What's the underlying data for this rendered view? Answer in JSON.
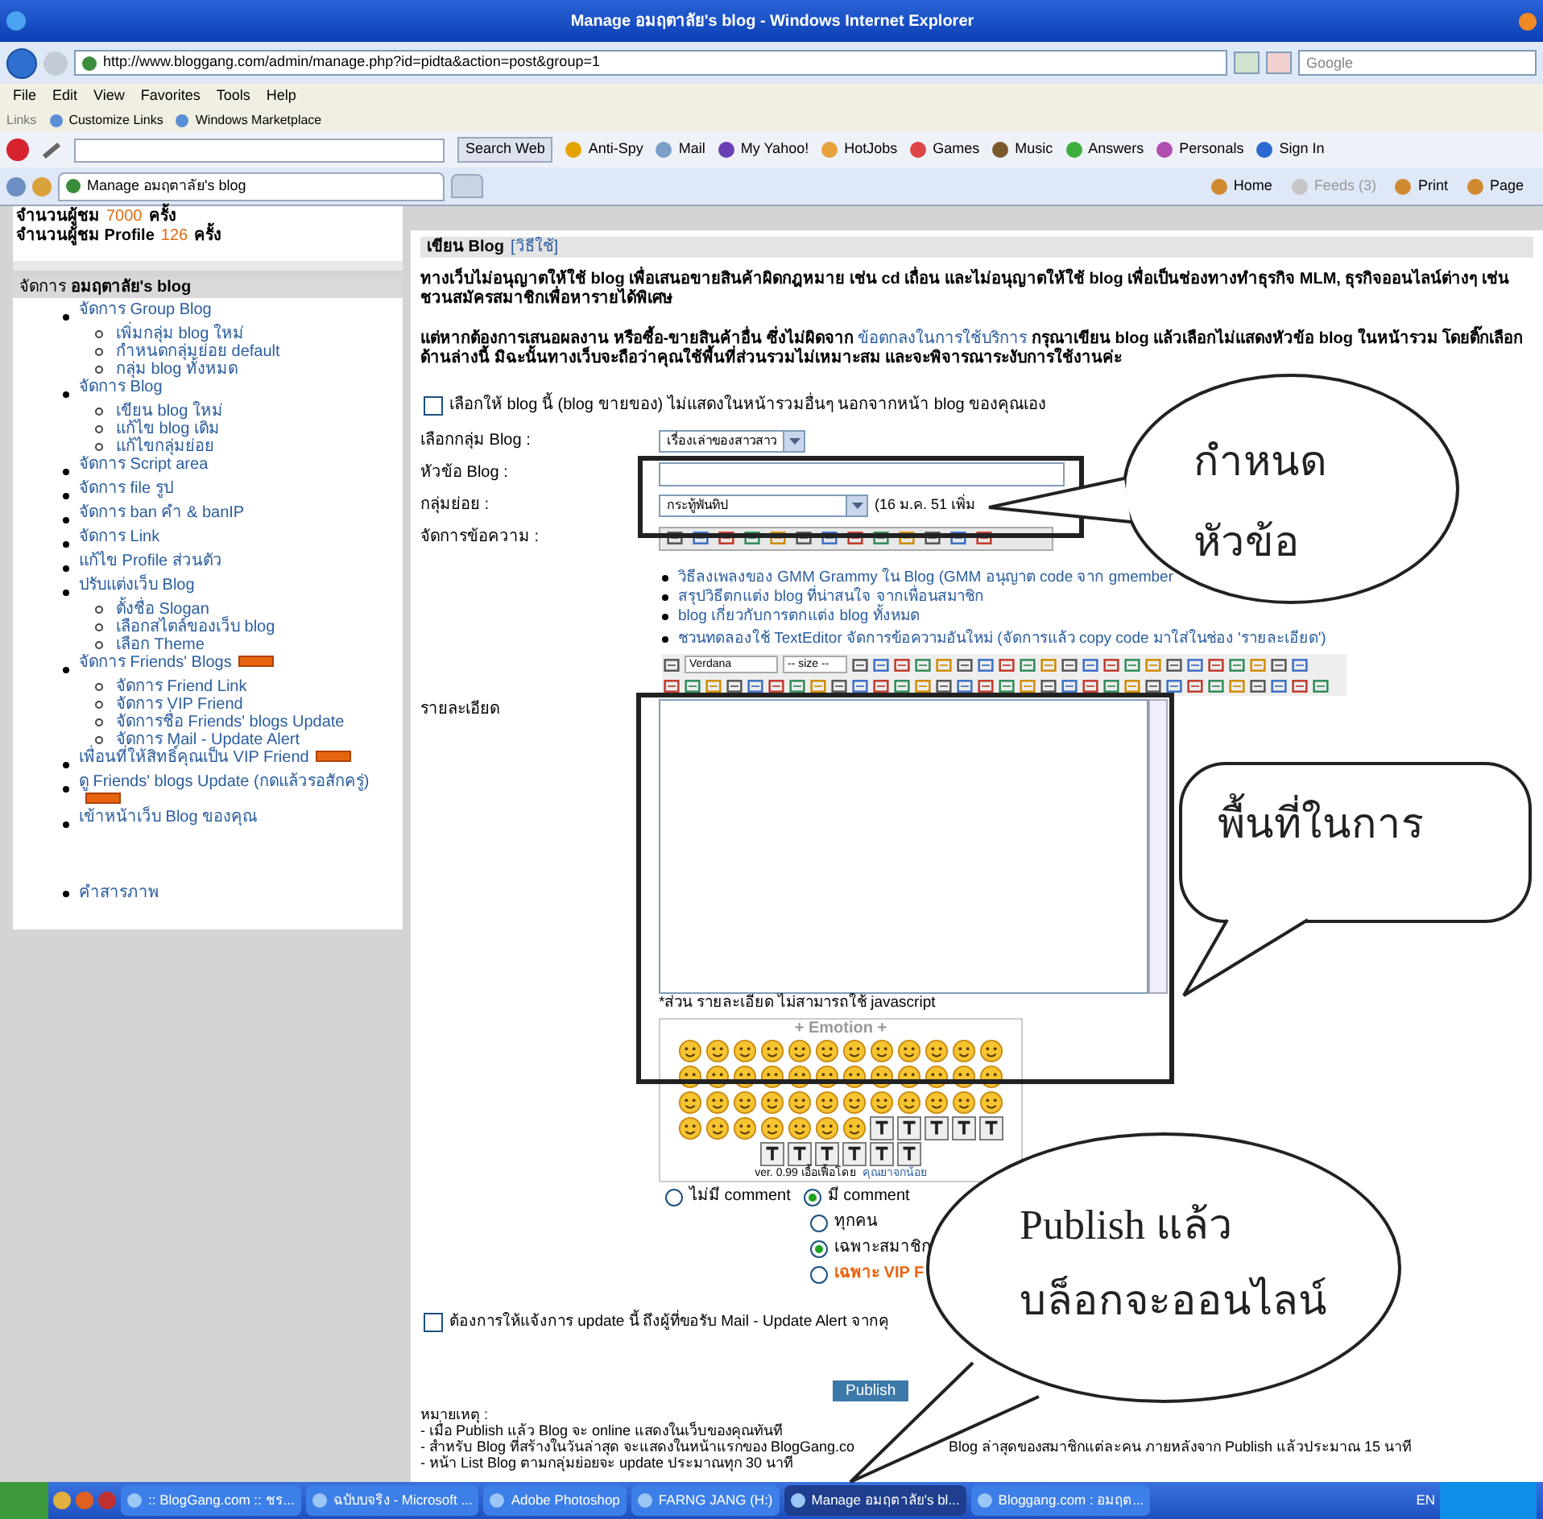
{
  "window": {
    "title": "Manage อมฤตาลัย's blog - Windows Internet Explorer"
  },
  "address_bar": {
    "url": "http://www.bloggang.com/admin/manage.php?id=pidta&action=post&group=1",
    "search_placeholder": "Google"
  },
  "menu": [
    "File",
    "Edit",
    "View",
    "Favorites",
    "Tools",
    "Help"
  ],
  "links_bar": {
    "label": "Links",
    "items": [
      "Customize Links",
      "Windows Marketplace"
    ]
  },
  "yahoo_toolbar": {
    "search_button": "Search Web",
    "items": [
      "Anti-Spy",
      "Mail",
      "My Yahoo!",
      "HotJobs",
      "Games",
      "Music",
      "Answers",
      "Personals",
      "Sign In"
    ]
  },
  "tab": {
    "title": "Manage อมฤตาลัย's blog"
  },
  "command_bar": [
    {
      "label": "Home",
      "disabled": false
    },
    {
      "label": "Feeds (3)",
      "disabled": true
    },
    {
      "label": "Print",
      "disabled": false
    },
    {
      "label": "Page",
      "disabled": false
    }
  ],
  "stats": [
    {
      "label": "จำนวนผู้ชม",
      "value": "7000",
      "unit": "ครั้ง"
    },
    {
      "label": "จำนวนผู้ชม Profile",
      "value": "126",
      "unit": "ครั้ง"
    }
  ],
  "sidebar": {
    "title": "จัดการ **อมฤตาลัย's blog**",
    "items": [
      {
        "label": "จัดการ Group Blog",
        "new": false,
        "children": [
          {
            "label": "เพิ่มกลุ่ม blog ใหม่"
          },
          {
            "label": "กำหนดกลุ่มย่อย default"
          },
          {
            "label": "กลุ่ม blog ทั้งหมด"
          }
        ]
      },
      {
        "label": "จัดการ Blog",
        "new": false,
        "children": [
          {
            "label": "เขียน blog ใหม่"
          },
          {
            "label": "แก้ไข blog เดิม"
          },
          {
            "label": "แก้ไขกลุ่มย่อย"
          }
        ]
      },
      {
        "label": "จัดการ Script area",
        "new": false
      },
      {
        "label": "จัดการ file รูป",
        "new": false
      },
      {
        "label": "จัดการ ban คำ & banIP",
        "new": false
      },
      {
        "label": "จัดการ Link",
        "new": false
      },
      {
        "label": "แก้ไข Profile ส่วนตัว",
        "new": false
      },
      {
        "label": "ปรับแต่งเว็บ Blog",
        "new": false,
        "children": [
          {
            "label": "ตั้งชื่อ Slogan"
          },
          {
            "label": "เลือกสไตล์ของเว็บ blog"
          },
          {
            "label": "เลือก Theme"
          }
        ]
      },
      {
        "label": "จัดการ Friends' Blogs",
        "new": true,
        "children": [
          {
            "label": "จัดการ Friend Link"
          },
          {
            "label": "จัดการ VIP Friend"
          },
          {
            "label": "จัดการชื่อ Friends' blogs Update"
          },
          {
            "label": "จัดการ Mail - Update Alert"
          }
        ]
      },
      {
        "label": "เพื่อนที่ให้สิทธิ์คุณเป็น VIP Friend",
        "new": true
      },
      {
        "label": "ดู Friends' blogs Update (กดแล้วรอสักครู่)",
        "new": true
      },
      {
        "label": "เข้าหน้าเว็บ Blog ของคุณ",
        "new": false
      }
    ],
    "extra_items": [
      "คำสารภาพ"
    ]
  },
  "main": {
    "heading": "เขียน Blog",
    "help_link": "[วิธีใช้]",
    "warning": "ทางเว็บไม่อนุญาตให้ใช้ blog เพื่อเสนอขายสินค้าผิดกฎหมาย เช่น cd เถื่อน และไม่อนุญาตให้ใช้ blog เพื่อเป็นช่องทางทำธุรกิจ MLM, ธุรกิจออนไลน์ต่างๆ เช่น ชวนสมัครสมาชิกเพื่อหารายได้พิเศษ",
    "notice_before": "แต่หากต้องการเสนอผลงาน หรือซื้อ-ขายสินค้าอื่น ซึ่งไม่ผิดจาก",
    "notice_link": "ข้อตกลงในการใช้บริการ",
    "notice_after": "กรุณาเขียน blog แล้วเลือกไม่แสดงหัวข้อ blog ในหน้ารวม โดยติ๊กเลือกด้านล่างนี้  มิฉะนั้นทางเว็บจะถือว่าคุณใช้พื้นที่ส่วนรวมไม่เหมาะสม และจะพิจารณาระงับการใช้งานค่ะ",
    "hide_checkbox": {
      "label": "เลือกให้ blog นี้ (blog ขายของ) ไม่แสดงในหน้ารวมอื่นๆ นอกจากหน้า blog ของคุณเอง",
      "checked": false
    },
    "group_label": "เลือกกลุ่ม Blog :",
    "group_value": "เรื่องเล่าของสาวสาว",
    "title_label": "หัวข้อ Blog :",
    "subgroup_label": "กลุ่มย่อย :",
    "subgroup_value": "กระทู้พันทิป",
    "subgroup_note": "(16 ม.ค. 51 เพิ่ม",
    "format_label": "จัดการข้อความ :",
    "help_links": [
      "วิธีลงเพลงของ GMM Grammy ใน Blog (GMM อนุญาต code จาก gmember",
      "สรุปวิธีตกแต่ง blog ที่น่าสนใจ จากเพื่อนสมาชิก",
      "blog เกี่ยวกับการตกแต่ง blog ทั้งหมด",
      "ชวนทดลองใช้ TextEditor จัดการข้อความอันใหม่ (จัดการแล้ว copy code มาใส่ในช่อง 'รายละเอียด')"
    ],
    "font_value": "Verdana",
    "size_value": "-- size --",
    "detail_label": "รายละเอียด",
    "detail_note": "*ส่วน รายละเอียด ไม่สามารถใช้ javascript",
    "emotion_title": "+ Emotion +",
    "emotion_credit": "ver. 0.99 เอื้อเฟื้อโดย",
    "emotion_author": "คุณยาจกน้อย",
    "comment_options": [
      {
        "label": "ไม่มี comment",
        "selected": false
      },
      {
        "label": "มี comment",
        "selected": true
      }
    ],
    "audience_options": [
      {
        "label": "ทุกคน",
        "selected": false,
        "kind": "normal"
      },
      {
        "label": "เฉพาะสมาชิก",
        "selected": true,
        "kind": "normal"
      },
      {
        "label": "เฉพาะ VIP F",
        "selected": false,
        "kind": "vip"
      }
    ],
    "alert_checkbox": {
      "label": "ต้องการให้แจ้งการ update นี้ ถึงผู้ที่ขอรับ Mail - Update Alert จากคุ",
      "checked": false
    },
    "publish_button": "Publish",
    "notes_title": "หมายเหตุ :",
    "notes": [
      {
        "parts": [
          "- เมื่อ Publish แล้ว Blog จะ online แสดงในเว็บของคุณทันที"
        ]
      },
      {
        "parts": [
          "- สำหรับ Blog ที่สร้างในวันล่าสุด จะแสดงในหน้าแรกของ BlogGang.co",
          "Blog ล่าสุดของสมาชิกแต่ละคน ภายหลังจาก Publish แล้วประมาณ 15 นาที"
        ]
      },
      {
        "parts": [
          "- หน้า List Blog ตามกลุ่มย่อยจะ update ประมาณทุก 30 นาที"
        ]
      }
    ]
  },
  "callouts": [
    {
      "kind": "ellipse",
      "lines": [
        "กำหนด",
        "หัวข้อ"
      ]
    },
    {
      "kind": "rounded",
      "lines": [
        "พื้นที่ในการ"
      ]
    },
    {
      "kind": "ellipse",
      "lines": [
        "Publish แล้ว",
        "บล็อกจะออนไลน์"
      ]
    }
  ],
  "taskbar": {
    "items": [
      {
        "label": ":: BlogGang.com :: ชร...",
        "selected": false
      },
      {
        "label": "ฉบับบจริง - Microsoft ...",
        "selected": false
      },
      {
        "label": "Adobe Photoshop",
        "selected": false
      },
      {
        "label": "FARNG JANG (H:)",
        "selected": false
      },
      {
        "label": "Manage อมฤตาลัย's bl...",
        "selected": true
      },
      {
        "label": "Bloggang.com : อมฤต...",
        "selected": false
      }
    ],
    "language": "EN"
  }
}
